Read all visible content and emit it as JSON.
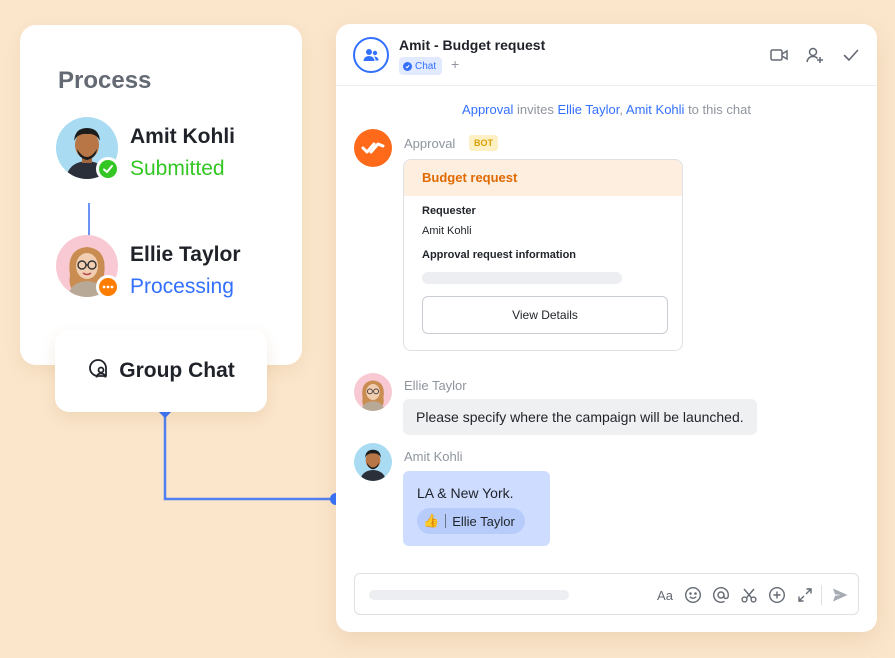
{
  "process": {
    "title": "Process",
    "steps": [
      {
        "name": "Amit Kohli",
        "status": "Submitted",
        "status_color": "#34c724"
      },
      {
        "name": "Ellie Taylor",
        "status": "Processing",
        "status_color": "#3370ff"
      }
    ]
  },
  "group_chat": {
    "label": "Group Chat",
    "icon": "group-chat-icon"
  },
  "chat": {
    "title": "Amit - Budget request",
    "tag": "Chat",
    "add_tag": "+",
    "header_icons": [
      "video-call-icon",
      "add-member-icon",
      "check-icon"
    ],
    "system_message": {
      "actor": "Approval",
      "verb": "invites",
      "invitee1": "Ellie Taylor",
      "comma": ",",
      "invitee2": "Amit Kohli",
      "suffix": "to this chat"
    },
    "bot": {
      "name": "Approval",
      "badge": "BOT",
      "card": {
        "title": "Budget request",
        "requester_label": "Requester",
        "requester_value": "Amit Kohli",
        "info_label": "Approval request information",
        "button": "View Details"
      }
    },
    "messages": [
      {
        "sender": "Ellie Taylor",
        "text": "Please specify where the campaign will be launched."
      },
      {
        "sender": "Amit Kohli",
        "text": "LA & New York.",
        "reaction": {
          "emoji": "👍",
          "by": "Ellie Taylor"
        }
      }
    ],
    "composer": {
      "tools": [
        "Aa",
        "emoji-icon",
        "mention-icon",
        "scissors-icon",
        "add-icon",
        "expand-icon",
        "send-icon"
      ]
    }
  },
  "colors": {
    "background": "#fbe6cc",
    "accent": "#3370ff",
    "success": "#34c724",
    "warning": "#ff7d00",
    "bot": "#ff6a1a"
  }
}
